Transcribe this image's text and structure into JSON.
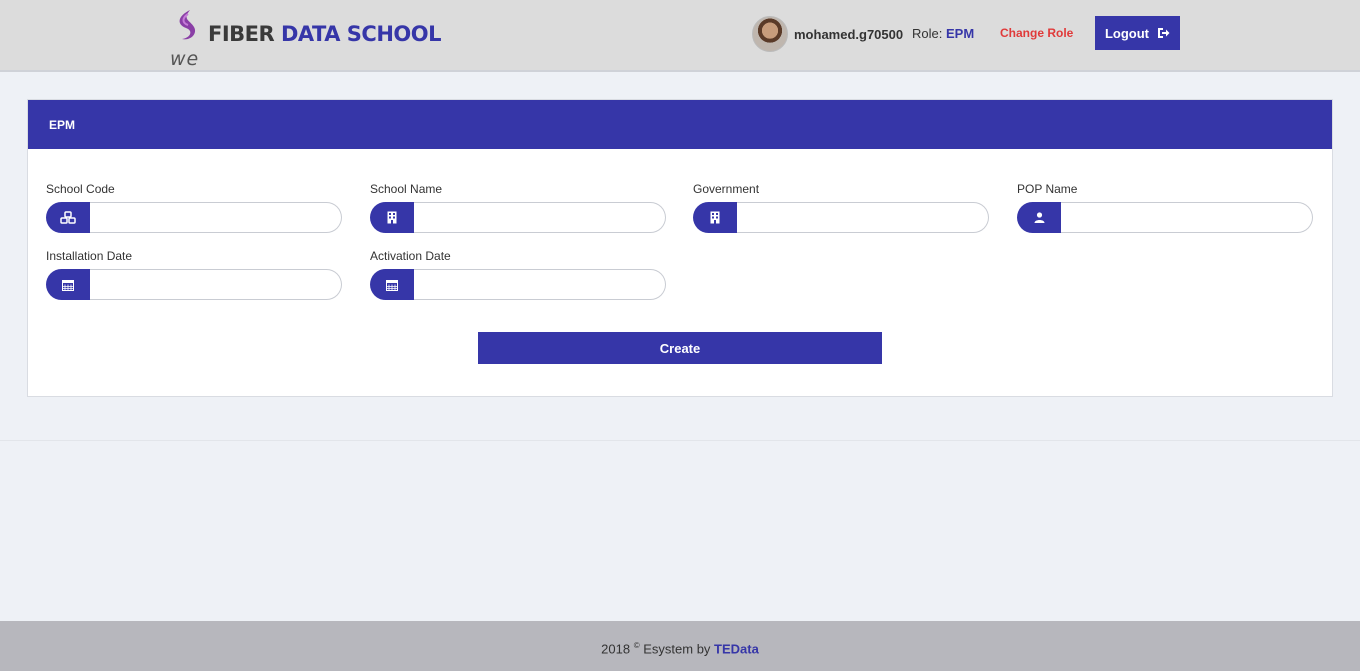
{
  "header": {
    "logo": {
      "brand_we": "we",
      "fiber": "FIBER",
      "data_school": "DATA SCHOOL"
    },
    "username": "mohamed.g70500",
    "role_label": "Role:",
    "role_value": "EPM",
    "change_role": "Change Role",
    "logout": "Logout"
  },
  "card": {
    "title": "EPM",
    "fields": [
      {
        "label": "School Code",
        "icon": "cubes-icon",
        "value": ""
      },
      {
        "label": "School Name",
        "icon": "building-icon",
        "value": ""
      },
      {
        "label": "Government",
        "icon": "building-icon",
        "value": ""
      },
      {
        "label": "POP Name",
        "icon": "user-icon",
        "value": ""
      },
      {
        "label": "Installation Date",
        "icon": "calendar-icon",
        "value": ""
      },
      {
        "label": "Activation Date",
        "icon": "calendar-icon",
        "value": ""
      }
    ],
    "create": "Create"
  },
  "footer": {
    "year": "2018",
    "text": "Esystem by",
    "brand": "TEData"
  },
  "colors": {
    "accent": "#3636a8",
    "danger": "#e03a3a",
    "header_bg": "#dcdcdc",
    "footer_bg": "#b7b7bd"
  }
}
